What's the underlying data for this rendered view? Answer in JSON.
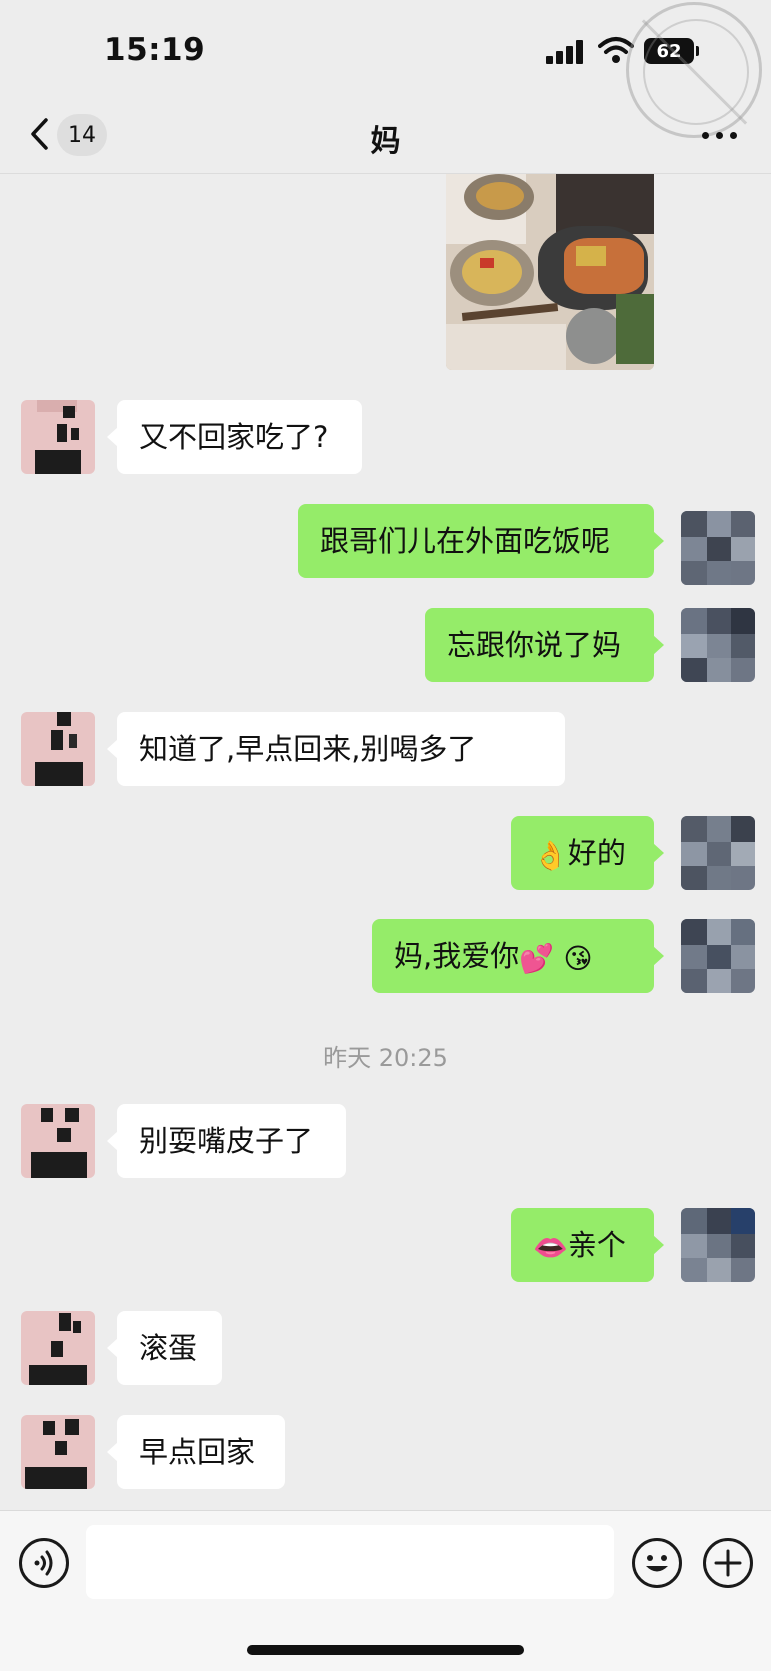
{
  "status_bar": {
    "time": "15:19",
    "battery": "62"
  },
  "nav": {
    "unread_count": "14",
    "title": "妈"
  },
  "messages": {
    "m1": "又不回家吃了?",
    "m2": "跟哥们儿在外面吃饭呢",
    "m3": "忘跟你说了妈",
    "m4": "知道了,早点回来,别喝多了",
    "m5": {
      "emoji": "👌",
      "text": "好的"
    },
    "m6": {
      "text": "妈,我爱你",
      "emoji1": "💕",
      "emoji2": "😘"
    },
    "m7": "别耍嘴皮子了",
    "m8": {
      "emoji": "👄",
      "text": "亲个"
    },
    "m9": "滚蛋",
    "m10": "早点回家"
  },
  "timestamp": "昨天 20:25",
  "input": {
    "value": ""
  },
  "icons": {
    "back": "chevron-left-icon",
    "more": "more-dots-icon",
    "voice": "voice-icon",
    "emoji": "smiley-icon",
    "plus": "plus-icon"
  },
  "colors": {
    "outgoing_bubble": "#95ec69",
    "incoming_bubble": "#ffffff",
    "background": "#ededed"
  }
}
